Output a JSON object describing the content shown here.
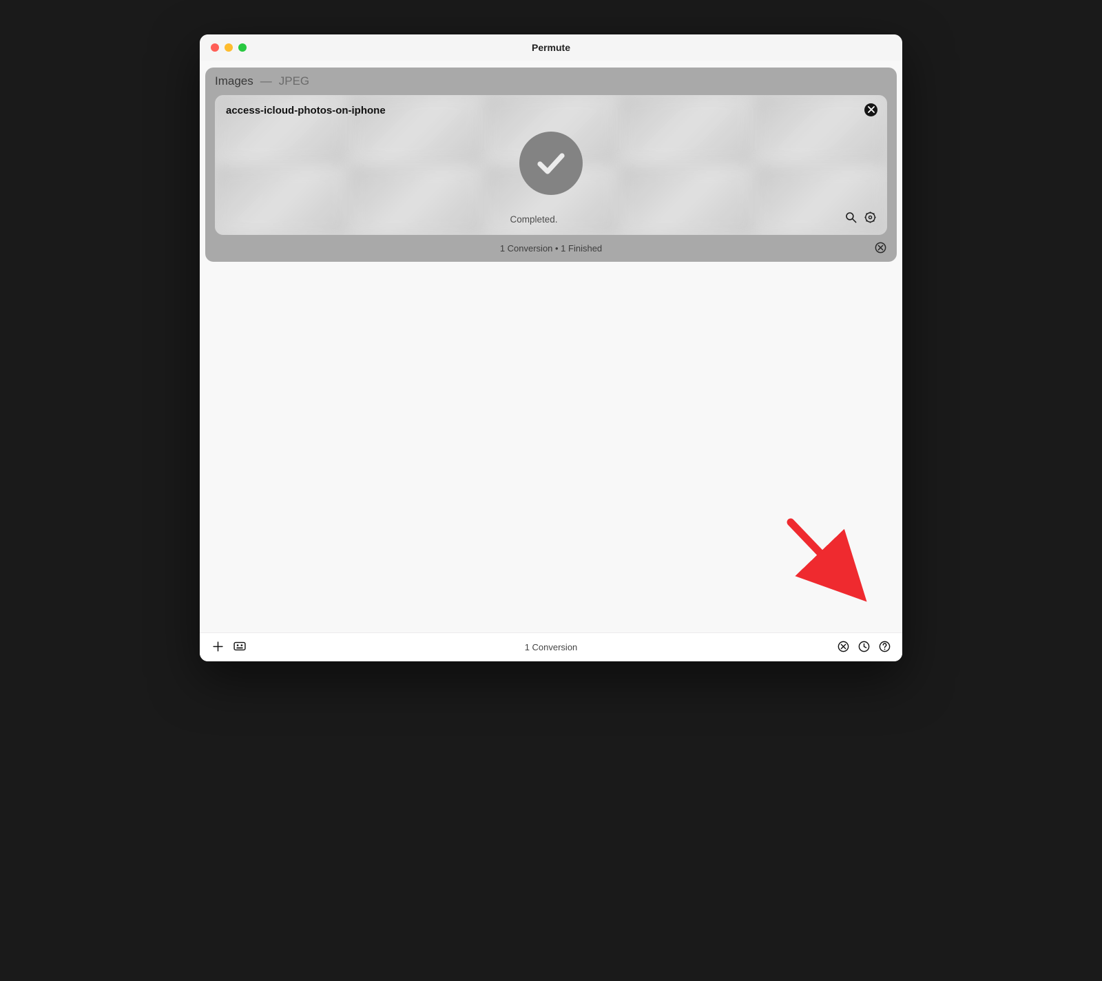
{
  "window": {
    "title": "Permute"
  },
  "group": {
    "category": "Images",
    "separator": "—",
    "format": "JPEG",
    "summary": "1 Conversion • 1 Finished"
  },
  "card": {
    "filename": "access-icloud-photos-on-iphone",
    "status": "Completed."
  },
  "bottom": {
    "status": "1 Conversion"
  },
  "icons": {
    "card_close": "close-icon",
    "reveal": "magnifier-icon",
    "settings": "gear-icon",
    "group_clear": "clear-icon",
    "add": "plus-icon",
    "robot": "robot-icon",
    "cancel": "cancel-circle-icon",
    "history": "clock-icon",
    "help": "question-circle-icon",
    "check": "checkmark-icon"
  }
}
